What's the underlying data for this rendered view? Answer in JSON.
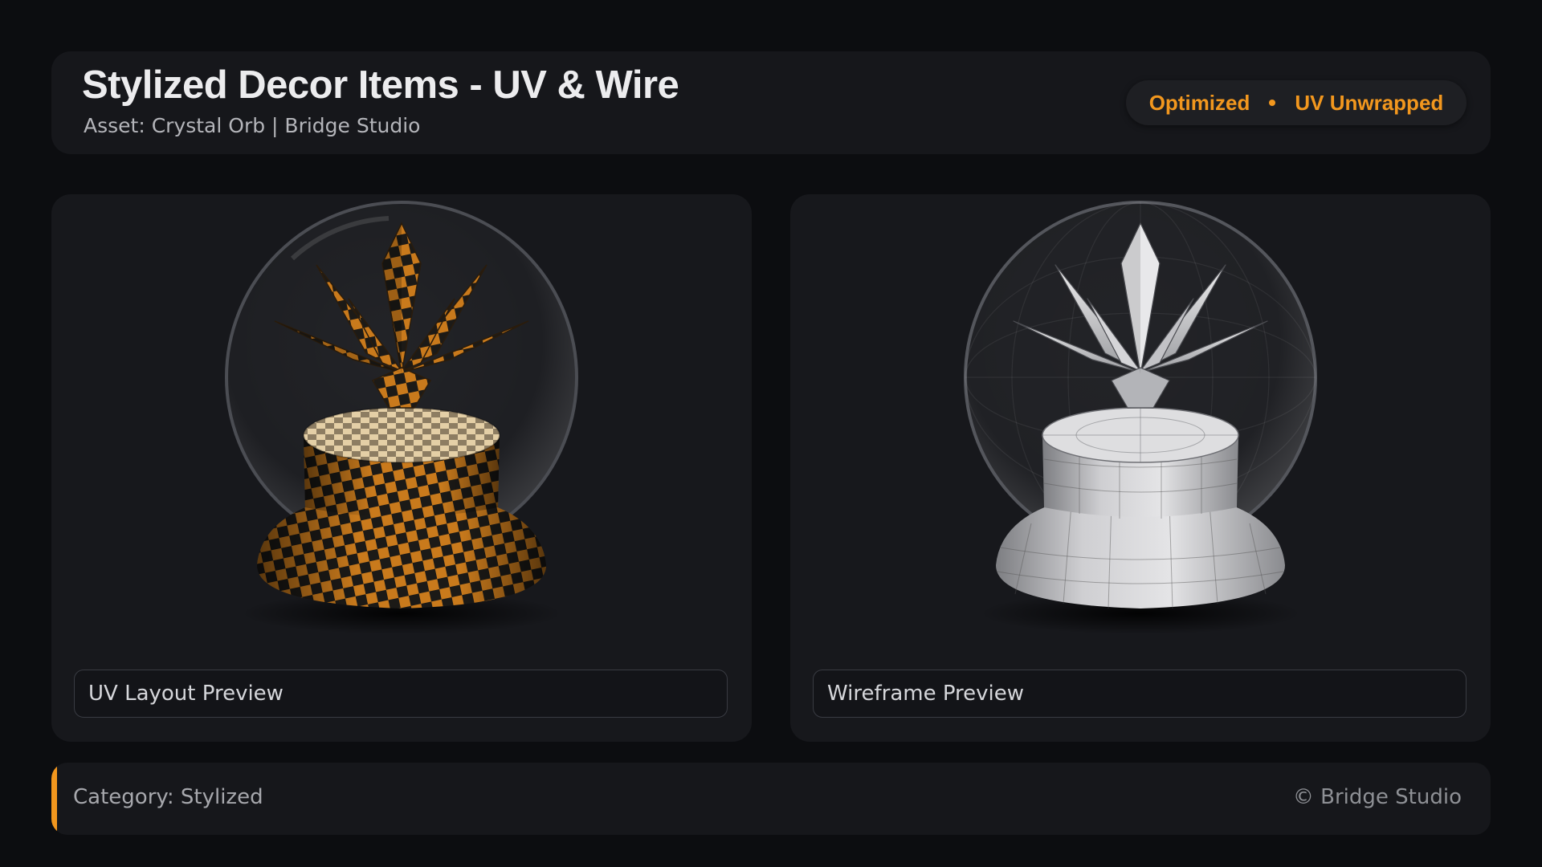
{
  "header": {
    "title": "Stylized Decor Items - UV & Wire",
    "subtitle": "Asset: Crystal Orb  |  Bridge Studio",
    "badges": [
      "Optimized",
      "UV Unwrapped"
    ]
  },
  "previews": [
    {
      "caption": "UV Layout Preview",
      "render_style": "uv-checker"
    },
    {
      "caption": "Wireframe Preview",
      "render_style": "wireframe-clay"
    }
  ],
  "footer": {
    "category": "Category: Stylized",
    "copyright": "© Bridge Studio"
  },
  "colors": {
    "accent": "#f2971e",
    "background": "#0c0d10",
    "panel": "#16171b",
    "checker_orange": "#c97a1c",
    "checker_dark": "#1c1a17",
    "clay": "#d9d9dc"
  }
}
